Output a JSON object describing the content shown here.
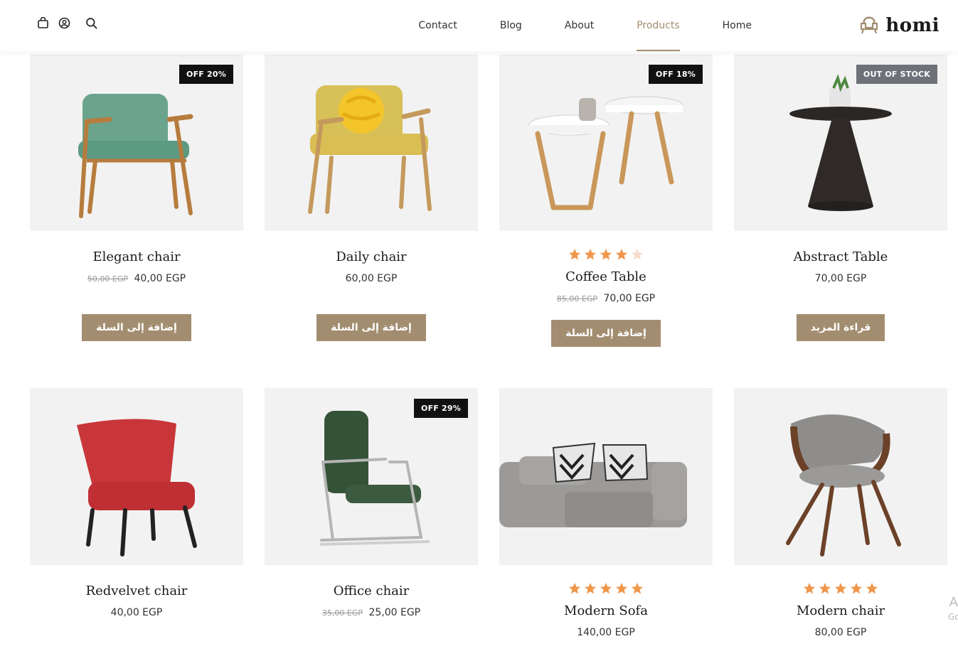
{
  "header": {
    "logo_text": "homi",
    "nav": [
      "Contact",
      "Blog",
      "About",
      "Products",
      "Home"
    ],
    "active_nav": "Products",
    "icons": [
      "bag-icon",
      "user-icon",
      "search-icon"
    ]
  },
  "colors": {
    "accent": "#a38d70",
    "badge": "#111111",
    "badge_out": "#6e7178",
    "star": "#f0964b",
    "star_empty": "#f5dccb",
    "tile": "#f2f2f2"
  },
  "products": [
    {
      "name": "Elegant chair",
      "old_price": "50,00 EGP",
      "price": "40,00 EGP",
      "badge": "OFF 20%",
      "button": "إضافة إلى السلة"
    },
    {
      "name": "Daily chair",
      "old_price": "",
      "price": "60,00 EGP",
      "badge": "",
      "button": "إضافة إلى السلة"
    },
    {
      "name": "Coffee Table",
      "old_price": "85,00 EGP",
      "price": "70,00 EGP",
      "badge": "OFF 18%",
      "rating": 4,
      "button": "إضافة إلى السلة"
    },
    {
      "name": "Abstract Table",
      "old_price": "",
      "price": "70,00 EGP",
      "badge": "OUT OF STOCK",
      "button": "قراءة المزيد"
    },
    {
      "name": "Redvelvet chair",
      "old_price": "",
      "price": "40,00 EGP",
      "badge": ""
    },
    {
      "name": "Office chair",
      "old_price": "35,00 EGP",
      "price": "25,00 EGP",
      "badge": "OFF 29%"
    },
    {
      "name": "Modern Sofa",
      "old_price": "",
      "price": "140,00 EGP",
      "badge": "",
      "rating": 5
    },
    {
      "name": "Modern chair",
      "old_price": "",
      "price": "80,00 EGP",
      "badge": "",
      "rating": 5
    }
  ],
  "side_mark": {
    "letter": "A",
    "small": "Go"
  }
}
